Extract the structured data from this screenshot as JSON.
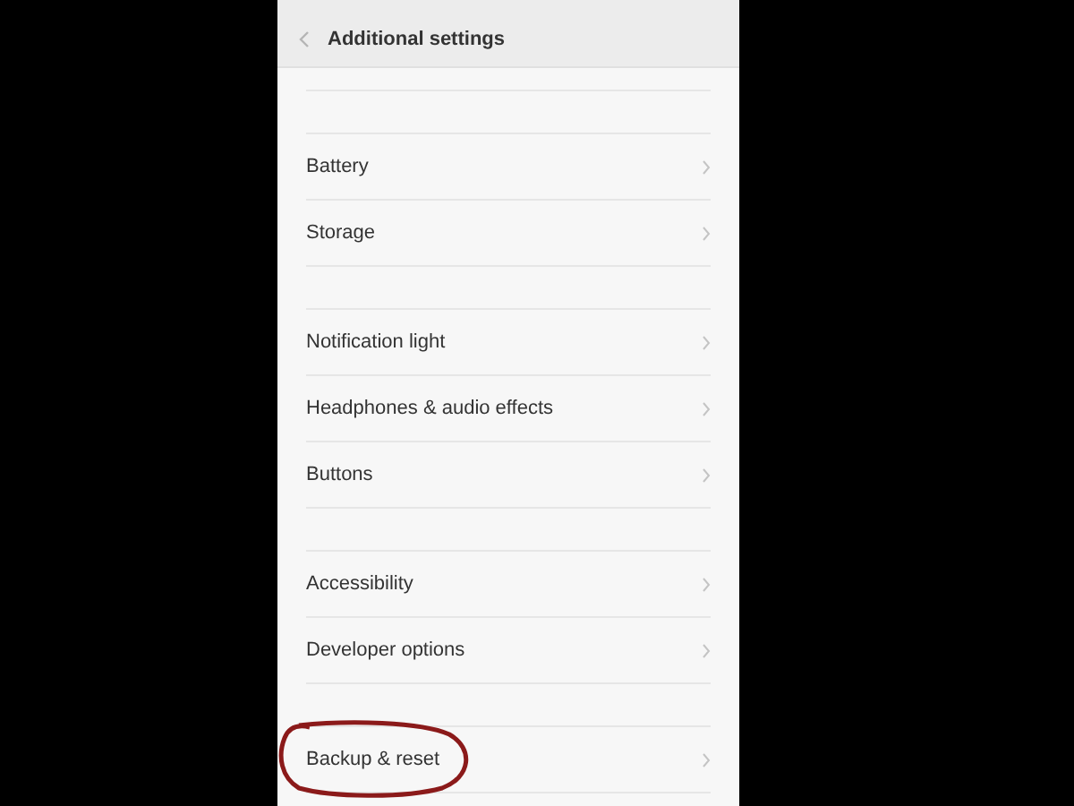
{
  "header": {
    "title": "Additional settings"
  },
  "sections": [
    {
      "items": [
        {
          "label": "Battery",
          "highlighted": false
        },
        {
          "label": "Storage",
          "highlighted": false
        }
      ]
    },
    {
      "items": [
        {
          "label": "Notification light",
          "highlighted": false
        },
        {
          "label": "Headphones & audio effects",
          "highlighted": false
        },
        {
          "label": "Buttons",
          "highlighted": false
        }
      ]
    },
    {
      "items": [
        {
          "label": "Accessibility",
          "highlighted": false
        },
        {
          "label": "Developer options",
          "highlighted": false
        }
      ]
    },
    {
      "items": [
        {
          "label": "Backup & reset",
          "highlighted": true
        }
      ]
    }
  ]
}
